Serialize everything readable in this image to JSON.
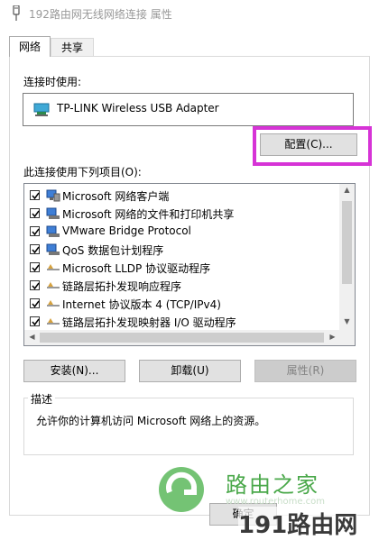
{
  "window": {
    "title": "192路由网无线网络连接 属性"
  },
  "tabs": [
    {
      "label": "网络"
    },
    {
      "label": "共享"
    }
  ],
  "connection": {
    "label": "连接时使用:",
    "adapter": "TP-LINK Wireless USB Adapter",
    "configure_button": "配置(C)..."
  },
  "items": {
    "label": "此连接使用下列项目(O):",
    "list": [
      {
        "name": "Microsoft 网络客户端",
        "checked": true,
        "icon": "network-client-icon"
      },
      {
        "name": "Microsoft 网络的文件和打印机共享",
        "checked": true,
        "icon": "network-service-icon"
      },
      {
        "name": "VMware Bridge Protocol",
        "checked": true,
        "icon": "network-service-icon"
      },
      {
        "name": "QoS 数据包计划程序",
        "checked": true,
        "icon": "network-service-icon"
      },
      {
        "name": "Microsoft LLDP 协议驱动程序",
        "checked": true,
        "icon": "protocol-icon"
      },
      {
        "name": "链路层拓扑发现响应程序",
        "checked": true,
        "icon": "protocol-icon"
      },
      {
        "name": "Internet 协议版本 4 (TCP/IPv4)",
        "checked": true,
        "icon": "protocol-icon"
      },
      {
        "name": "链路层拓扑发现映射器 I/O 驱动程序",
        "checked": true,
        "icon": "protocol-icon"
      }
    ]
  },
  "buttons": {
    "install": "安装(N)...",
    "uninstall": "卸载(U)",
    "properties": "属性(R)",
    "ok": "确定"
  },
  "description": {
    "legend": "描述",
    "text": "允许你的计算机访问 Microsoft 网络上的资源。"
  },
  "watermark": {
    "brand": "路由之家",
    "url": "www.routerhome.com",
    "brand2": "191路由网"
  },
  "colors": {
    "highlight": "#d633d6",
    "watermark_green": "#4aa84a"
  }
}
